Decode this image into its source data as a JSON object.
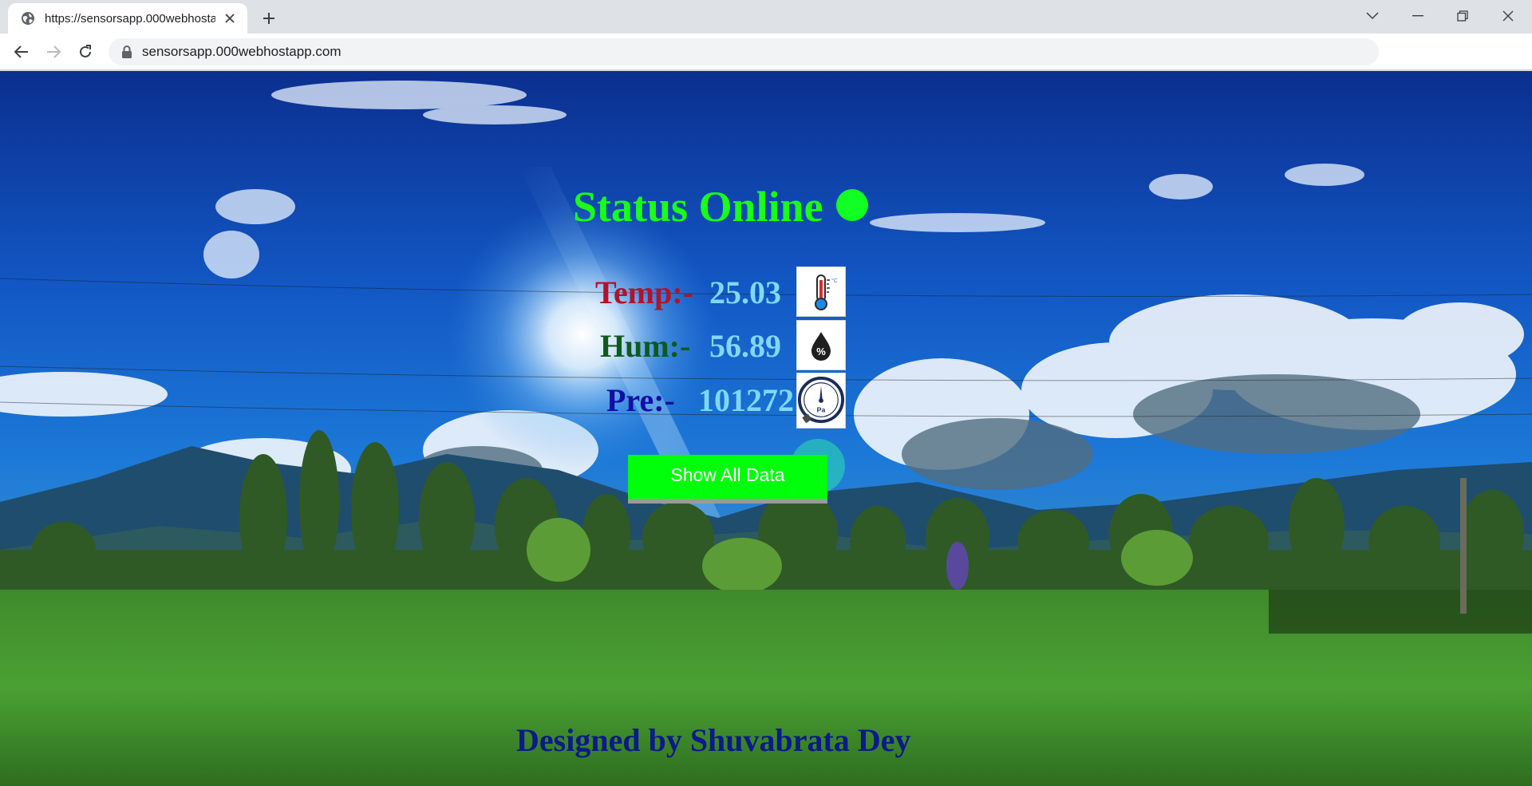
{
  "browser": {
    "tab_title": "https://sensorsapp.000webhostapp.com",
    "url": "sensorsapp.000webhostapp.com"
  },
  "page": {
    "status_text": "Status Online",
    "status_color": "#11ff22",
    "readings": [
      {
        "label": "Temp:-",
        "value": "25.03",
        "icon": "thermometer-icon",
        "color": "#b01429"
      },
      {
        "label": "Hum:-",
        "value": "56.89",
        "icon": "humidity-drop-icon",
        "color": "#0e5a1e"
      },
      {
        "label": "Pre:-",
        "value": "101272",
        "icon": "pressure-gauge-icon",
        "color": "#100fa6"
      }
    ],
    "show_button_label": "Show All Data",
    "footer": "Designed by Shuvabrata Dey"
  }
}
